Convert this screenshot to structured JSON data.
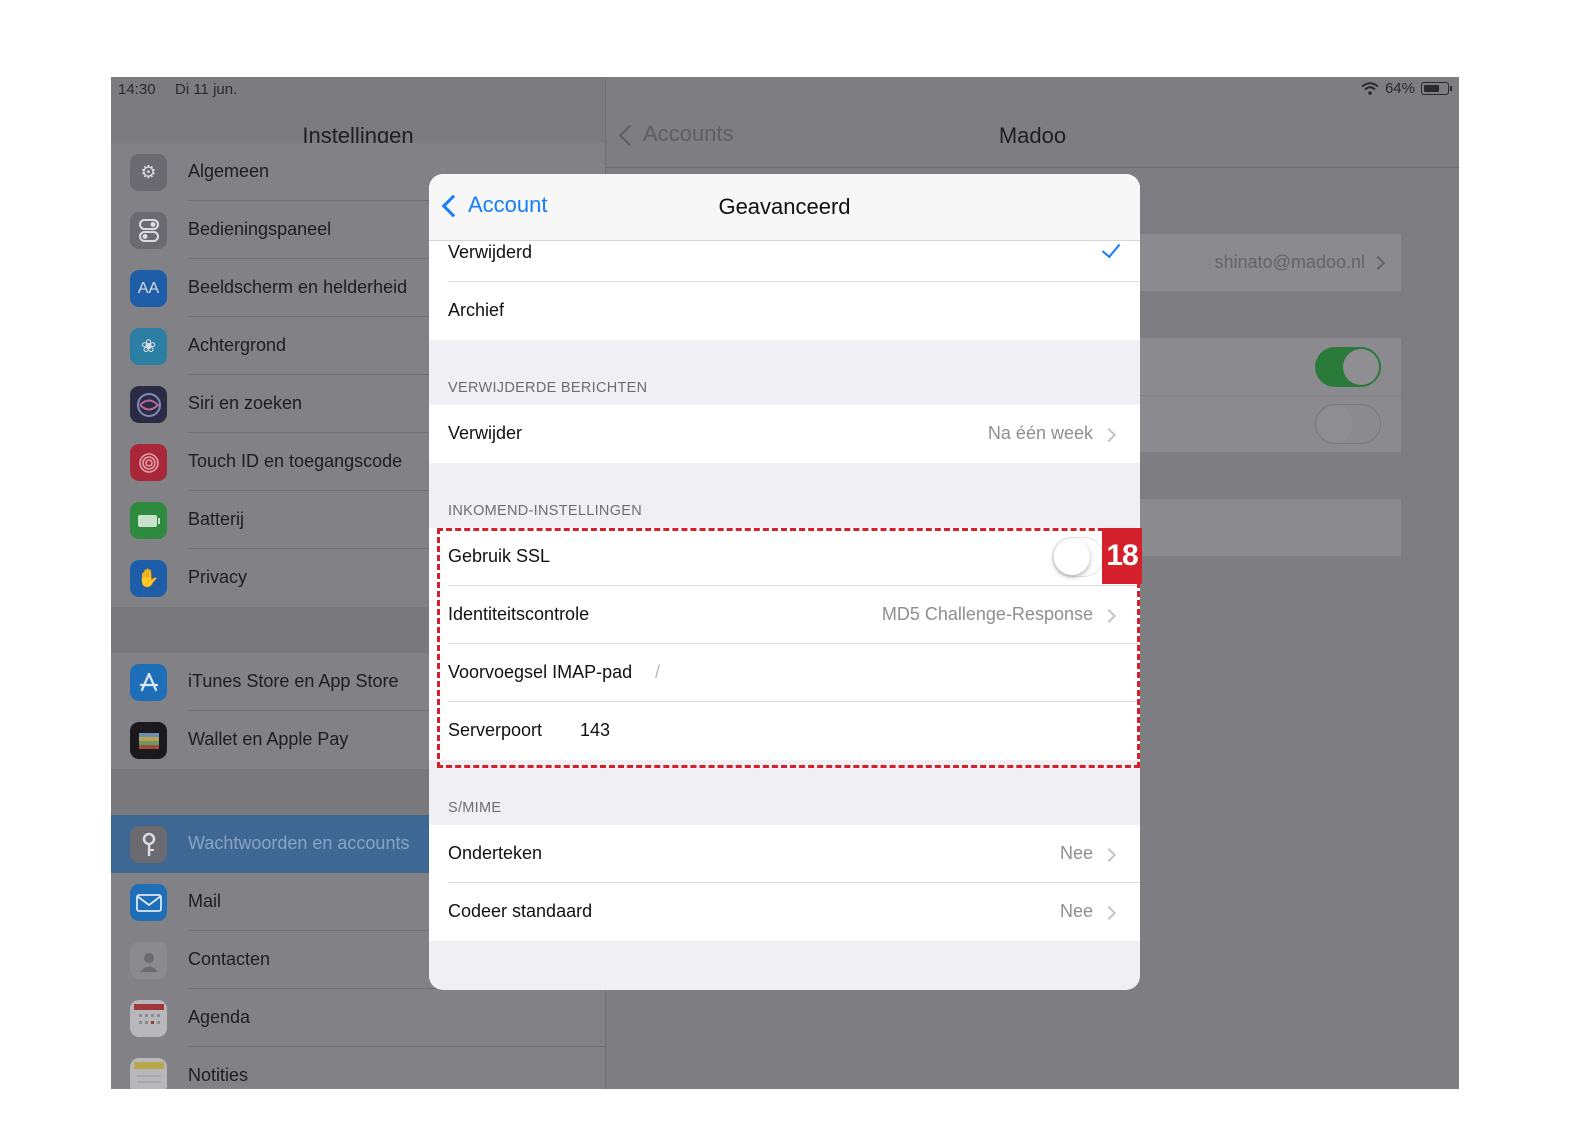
{
  "status_bar": {
    "time": "14:30",
    "date": "Di 11 jun.",
    "battery": "64%"
  },
  "sidebar": {
    "title": "Instellingen",
    "items": [
      {
        "label": "Algemeen",
        "icon": "gear-icon",
        "color": "#6a6a70"
      },
      {
        "label": "Bedieningspaneel",
        "icon": "switches-icon",
        "color": "#6a6a70"
      },
      {
        "label": "Beeldscherm en helderheid",
        "icon": "text-size-icon",
        "color": "#1e5ea8"
      },
      {
        "label": "Achtergrond",
        "icon": "flower-icon",
        "color": "#2a7fa3"
      },
      {
        "label": "Siri en zoeken",
        "icon": "siri-icon",
        "color": "#2b2b45"
      },
      {
        "label": "Touch ID en toegangscode",
        "icon": "fingerprint-icon",
        "color": "#a8283a"
      },
      {
        "label": "Batterij",
        "icon": "battery-icon",
        "color": "#2e8a3e"
      },
      {
        "label": "Privacy",
        "icon": "hand-icon",
        "color": "#1e5ea8"
      },
      {
        "label": "iTunes Store en App Store",
        "icon": "app-store-icon",
        "color": "#1e6fb8"
      },
      {
        "label": "Wallet en Apple Pay",
        "icon": "wallet-icon",
        "color": "#1a1a1c"
      },
      {
        "label": "Wachtwoorden en accounts",
        "icon": "key-icon",
        "color": "#6a6a70"
      },
      {
        "label": "Mail",
        "icon": "envelope-icon",
        "color": "#1e6fb8"
      },
      {
        "label": "Contacten",
        "icon": "contacts-icon",
        "color": "#8a8a8f"
      },
      {
        "label": "Agenda",
        "icon": "calendar-icon",
        "color": "#b8b8bc"
      },
      {
        "label": "Notities",
        "icon": "notes-icon",
        "color": "#b8a84a"
      }
    ]
  },
  "detail": {
    "back_label": "Accounts",
    "title": "Madoo",
    "email": "shinato@madoo.nl"
  },
  "modal": {
    "back_label": "Account",
    "title": "Geavanceerd",
    "top_rows": [
      {
        "label": "Verwijderd",
        "checked": true
      },
      {
        "label": "Archief"
      }
    ],
    "deleted_section": {
      "header": "VERWIJDERDE BERICHTEN",
      "rows": [
        {
          "label": "Verwijder",
          "value": "Na één week"
        }
      ]
    },
    "incoming_section": {
      "header": "INKOMEND-INSTELLINGEN",
      "ssl_label": "Gebruik SSL",
      "ssl_on": false,
      "auth_label": "Identiteitscontrole",
      "auth_value": "MD5 Challenge-Response",
      "imap_label": "Voorvoegsel IMAP-pad",
      "imap_value": "/",
      "port_label": "Serverpoort",
      "port_value": "143"
    },
    "smime_section": {
      "header": "S/MIME",
      "rows": [
        {
          "label": "Onderteken",
          "value": "Nee"
        },
        {
          "label": "Codeer standaard",
          "value": "Nee"
        }
      ]
    }
  },
  "annotation": {
    "number": "18",
    "color": "#d4202a"
  }
}
